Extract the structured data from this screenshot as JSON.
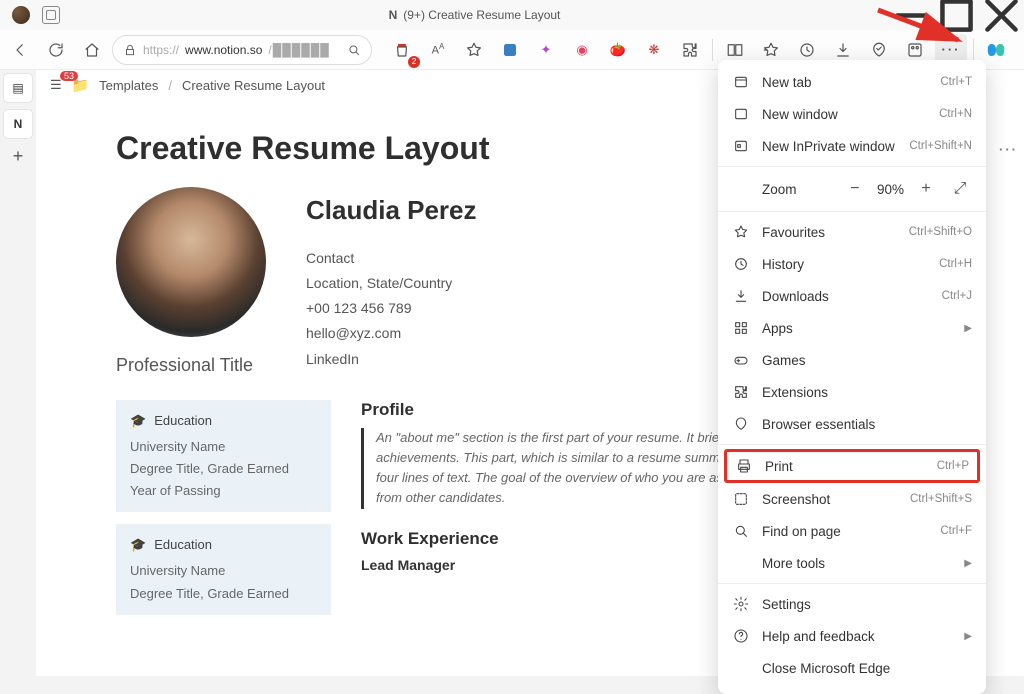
{
  "window": {
    "title": "(9+) Creative Resume Layout",
    "app_icon": "N"
  },
  "url": {
    "scheme": "https://",
    "host": "www.notion.so",
    "path_display": "/██████"
  },
  "breadcrumb": {
    "badge": "53",
    "folder": "Templates",
    "page": "Creative Resume Layout"
  },
  "resume": {
    "heading": "Creative Resume Layout",
    "name": "Claudia Perez",
    "lines": {
      "contact": "Contact",
      "location": "Location, State/Country",
      "phone": "+00 123 456 789",
      "email": "hello@xyz.com",
      "linkedin": "LinkedIn"
    },
    "professional_title": "Professional Title",
    "education": [
      {
        "title": "Education",
        "uni": "University Name",
        "degree": "Degree Title, Grade Earned",
        "year": "Year of Passing"
      },
      {
        "title": "Education",
        "uni": "University Name",
        "degree": "Degree Title, Grade Earned"
      }
    ],
    "profile_title": "Profile",
    "profile_body": "An \"about me\" section is the first part of your resume. It briefly describes your talents, and achievements. This part, which is similar to a resume summary in tone, is normally between three and four lines of text. The goal of the overview of who you are as a professional and what sets you apart from other candidates.",
    "work_title": "Work Experience",
    "work_role": "Lead Manager"
  },
  "menu": {
    "new_tab": "New tab",
    "new_tab_k": "Ctrl+T",
    "new_window": "New window",
    "new_window_k": "Ctrl+N",
    "inprivate": "New InPrivate window",
    "inprivate_k": "Ctrl+Shift+N",
    "zoom_label": "Zoom",
    "zoom_value": "90%",
    "favourites": "Favourites",
    "favourites_k": "Ctrl+Shift+O",
    "history": "History",
    "history_k": "Ctrl+H",
    "downloads": "Downloads",
    "downloads_k": "Ctrl+J",
    "apps": "Apps",
    "games": "Games",
    "extensions": "Extensions",
    "essentials": "Browser essentials",
    "print": "Print",
    "print_k": "Ctrl+P",
    "screenshot": "Screenshot",
    "screenshot_k": "Ctrl+Shift+S",
    "find": "Find on page",
    "find_k": "Ctrl+F",
    "more_tools": "More tools",
    "settings": "Settings",
    "help": "Help and feedback",
    "close": "Close Microsoft Edge"
  }
}
